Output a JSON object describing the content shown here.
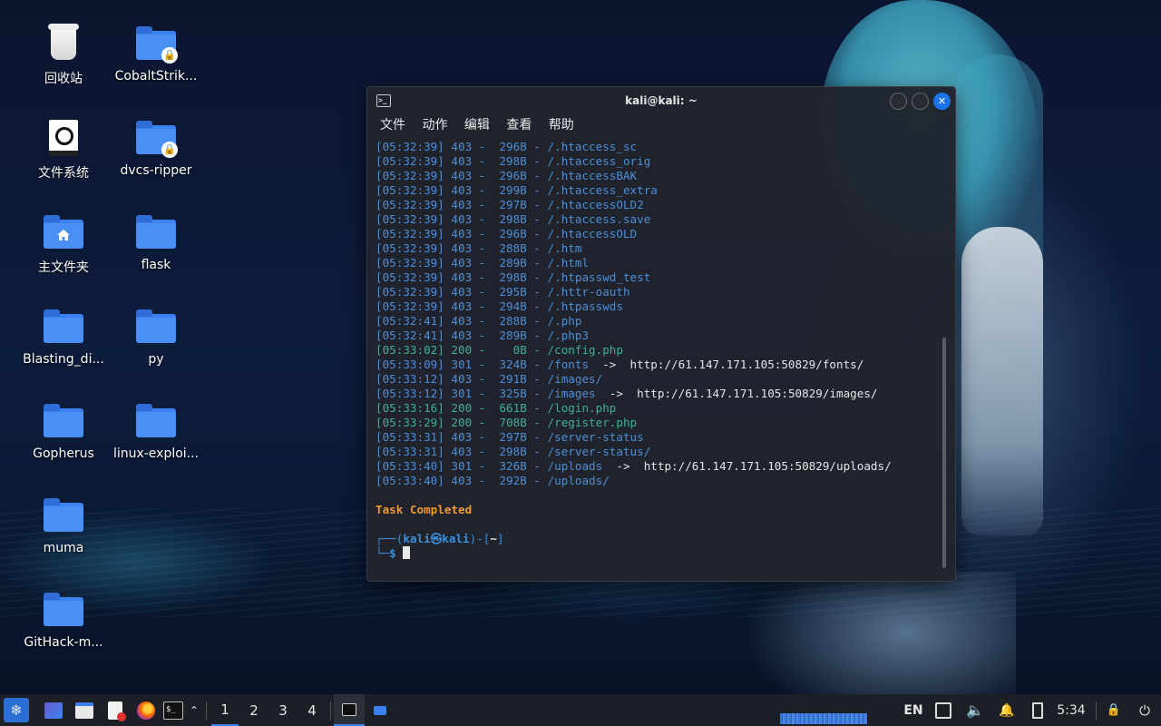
{
  "desktop": {
    "icons": [
      {
        "label": "回收站",
        "type": "trash"
      },
      {
        "label": "CobaltStrik...",
        "type": "folder-locked"
      },
      {
        "label": "文件系统",
        "type": "drive"
      },
      {
        "label": "dvcs-ripper",
        "type": "folder-locked"
      },
      {
        "label": "主文件夹",
        "type": "folder-home"
      },
      {
        "label": "flask",
        "type": "folder"
      },
      {
        "label": "Blasting_di...",
        "type": "folder"
      },
      {
        "label": "py",
        "type": "folder"
      },
      {
        "label": "Gopherus",
        "type": "folder"
      },
      {
        "label": "linux-exploi...",
        "type": "folder"
      },
      {
        "label": "muma",
        "type": "folder"
      },
      {
        "label": "GitHack-m...",
        "type": "folder"
      }
    ]
  },
  "terminal": {
    "title": "kali@kali: ~",
    "menu": [
      "文件",
      "动作",
      "编辑",
      "查看",
      "帮助"
    ],
    "lines": [
      {
        "time": "[05:32:39]",
        "code": "403",
        "size": "296B",
        "path": "/.htaccess_sc"
      },
      {
        "time": "[05:32:39]",
        "code": "403",
        "size": "298B",
        "path": "/.htaccess_orig"
      },
      {
        "time": "[05:32:39]",
        "code": "403",
        "size": "296B",
        "path": "/.htaccessBAK"
      },
      {
        "time": "[05:32:39]",
        "code": "403",
        "size": "299B",
        "path": "/.htaccess_extra"
      },
      {
        "time": "[05:32:39]",
        "code": "403",
        "size": "297B",
        "path": "/.htaccessOLD2"
      },
      {
        "time": "[05:32:39]",
        "code": "403",
        "size": "298B",
        "path": "/.htaccess.save"
      },
      {
        "time": "[05:32:39]",
        "code": "403",
        "size": "296B",
        "path": "/.htaccessOLD"
      },
      {
        "time": "[05:32:39]",
        "code": "403",
        "size": "288B",
        "path": "/.htm"
      },
      {
        "time": "[05:32:39]",
        "code": "403",
        "size": "289B",
        "path": "/.html"
      },
      {
        "time": "[05:32:39]",
        "code": "403",
        "size": "298B",
        "path": "/.htpasswd_test"
      },
      {
        "time": "[05:32:39]",
        "code": "403",
        "size": "295B",
        "path": "/.httr-oauth"
      },
      {
        "time": "[05:32:39]",
        "code": "403",
        "size": "294B",
        "path": "/.htpasswds"
      },
      {
        "time": "[05:32:41]",
        "code": "403",
        "size": "288B",
        "path": "/.php"
      },
      {
        "time": "[05:32:41]",
        "code": "403",
        "size": "289B",
        "path": "/.php3"
      },
      {
        "time": "[05:33:02]",
        "code": "200",
        "size": "0B",
        "path": "/config.php"
      },
      {
        "time": "[05:33:09]",
        "code": "301",
        "size": "324B",
        "path": "/fonts",
        "redirect": "http://61.147.171.105:50829/fonts/"
      },
      {
        "time": "[05:33:12]",
        "code": "403",
        "size": "291B",
        "path": "/images/"
      },
      {
        "time": "[05:33:12]",
        "code": "301",
        "size": "325B",
        "path": "/images",
        "redirect": "http://61.147.171.105:50829/images/"
      },
      {
        "time": "[05:33:16]",
        "code": "200",
        "size": "661B",
        "path": "/login.php"
      },
      {
        "time": "[05:33:29]",
        "code": "200",
        "size": "708B",
        "path": "/register.php"
      },
      {
        "time": "[05:33:31]",
        "code": "403",
        "size": "297B",
        "path": "/server-status"
      },
      {
        "time": "[05:33:31]",
        "code": "403",
        "size": "298B",
        "path": "/server-status/"
      },
      {
        "time": "[05:33:40]",
        "code": "301",
        "size": "326B",
        "path": "/uploads",
        "redirect": "http://61.147.171.105:50829/uploads/"
      },
      {
        "time": "[05:33:40]",
        "code": "403",
        "size": "292B",
        "path": "/uploads/"
      }
    ],
    "completed_text": "Task Completed",
    "prompt": {
      "user": "kali",
      "host": "kali",
      "dir": "~",
      "symbol": "$"
    },
    "arrow": "->"
  },
  "taskbar": {
    "workspaces": [
      "1",
      "2",
      "3",
      "4"
    ],
    "active_workspace": "1",
    "keyboard_layout": "EN",
    "clock": "5:34",
    "colors": {
      "accent": "#3b82f0",
      "bar": "#1c1f26"
    }
  }
}
